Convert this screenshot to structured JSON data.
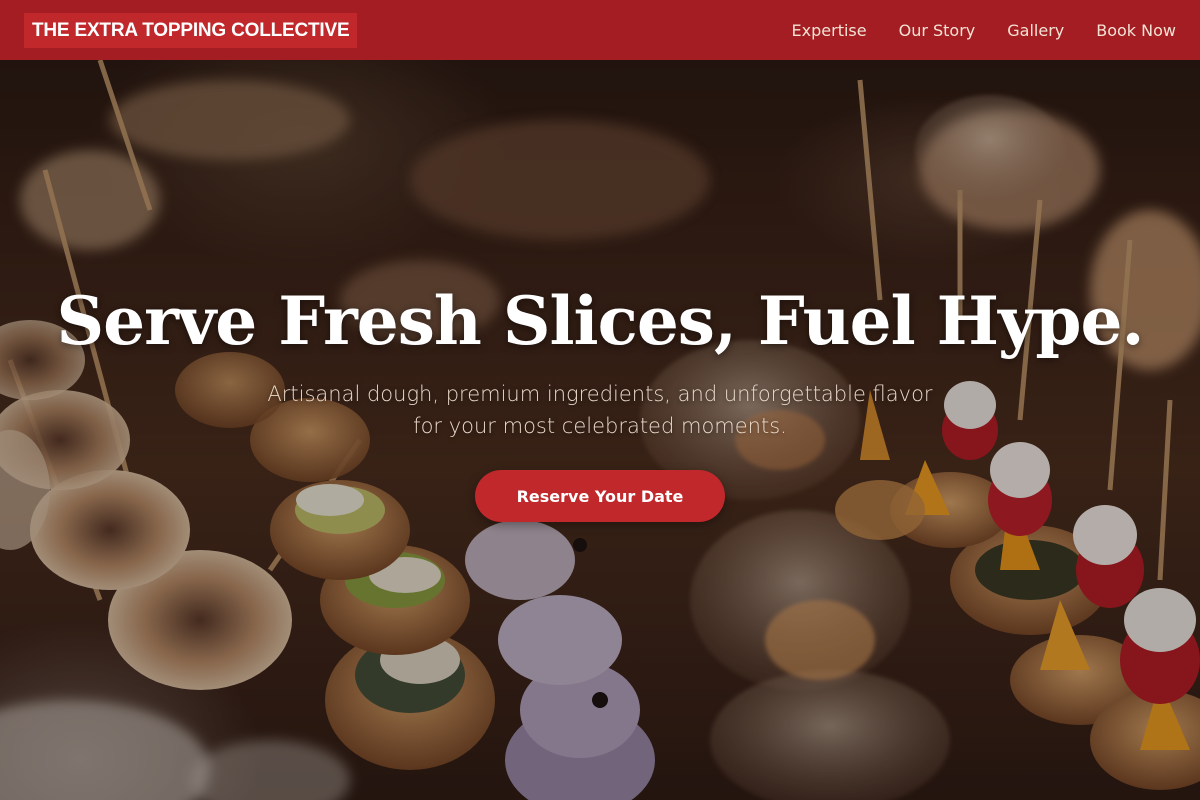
{
  "header": {
    "brand": "THE EXTRA TOPPING COLLECTIVE",
    "nav": [
      {
        "label": "Expertise"
      },
      {
        "label": "Our Story"
      },
      {
        "label": "Gallery"
      },
      {
        "label": "Book Now"
      }
    ]
  },
  "hero": {
    "title": "Serve Fresh Slices, Fuel Hype.",
    "subtitle": "Artisanal dough, premium ingredients, and unforgettable flavor for your most celebrated moments.",
    "cta_label": "Reserve Your Date"
  },
  "colors": {
    "header_bg": "#a31d23",
    "brand_bg": "#c0282c",
    "cta_bg": "#c0282c",
    "nav_text": "#f4e3d5",
    "title_text": "#ffffff"
  }
}
